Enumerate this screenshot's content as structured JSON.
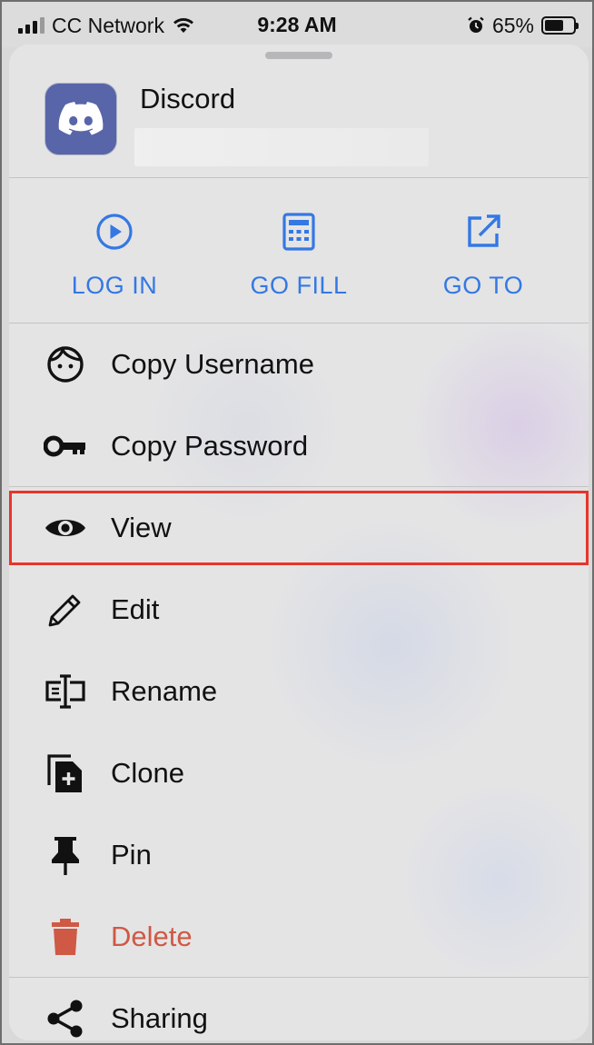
{
  "status_bar": {
    "carrier": "CC Network",
    "time": "9:28 AM",
    "battery": "65%",
    "battery_level": 0.65
  },
  "app": {
    "title": "Discord",
    "icon": "discord-logo-icon"
  },
  "actions": [
    {
      "label": "LOG IN",
      "icon": "play-circle-icon"
    },
    {
      "label": "GO FILL",
      "icon": "calculator-icon"
    },
    {
      "label": "GO TO",
      "icon": "external-link-icon"
    }
  ],
  "menu": {
    "copy_username": "Copy Username",
    "copy_password": "Copy Password",
    "view": "View",
    "edit": "Edit",
    "rename": "Rename",
    "clone": "Clone",
    "pin": "Pin",
    "delete": "Delete",
    "sharing": "Sharing"
  },
  "colors": {
    "accent": "#3478e3",
    "danger": "#cf5945",
    "highlight": "#e8352a",
    "discord": "#5865a8"
  }
}
